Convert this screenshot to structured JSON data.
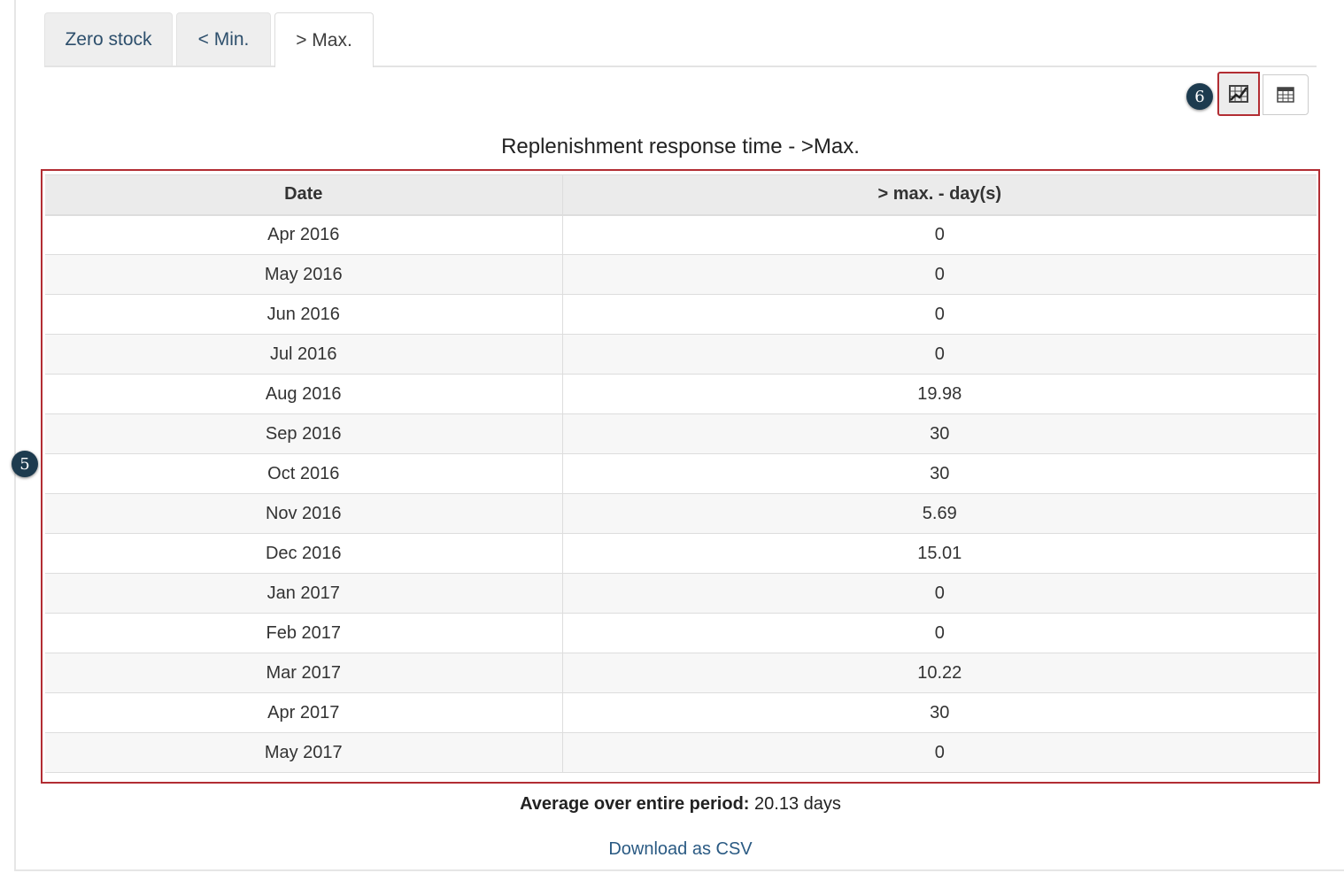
{
  "tabs": [
    {
      "label": "Zero stock",
      "active": false
    },
    {
      "label": "< Min.",
      "active": false
    },
    {
      "label": "> Max.",
      "active": true
    }
  ],
  "markers": {
    "view_toggle": "6",
    "table_area": "5"
  },
  "view_toggle": {
    "chart_icon": "chart-icon",
    "table_icon": "table-icon",
    "selected": "chart"
  },
  "title": "Replenishment response time - >Max.",
  "table": {
    "columns": [
      "Date",
      "> max. - day(s)"
    ],
    "rows": [
      [
        "Apr 2016",
        "0"
      ],
      [
        "May 2016",
        "0"
      ],
      [
        "Jun 2016",
        "0"
      ],
      [
        "Jul 2016",
        "0"
      ],
      [
        "Aug 2016",
        "19.98"
      ],
      [
        "Sep 2016",
        "30"
      ],
      [
        "Oct 2016",
        "30"
      ],
      [
        "Nov 2016",
        "5.69"
      ],
      [
        "Dec 2016",
        "15.01"
      ],
      [
        "Jan 2017",
        "0"
      ],
      [
        "Feb 2017",
        "0"
      ],
      [
        "Mar 2017",
        "10.22"
      ],
      [
        "Apr 2017",
        "30"
      ],
      [
        "May 2017",
        "0"
      ]
    ]
  },
  "summary": {
    "label": "Average over entire period:",
    "value": "20.13 days"
  },
  "download_label": "Download as CSV",
  "colors": {
    "highlight": "#b22d33",
    "marker": "#1d3b4f",
    "link": "#2a5a83"
  }
}
